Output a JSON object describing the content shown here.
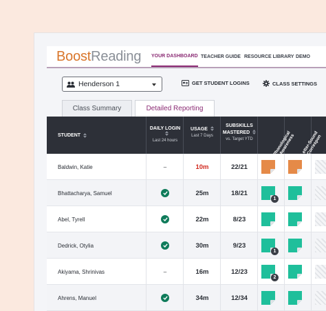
{
  "brand": {
    "part1": "Boost",
    "part2": "Reading"
  },
  "nav": [
    {
      "label": "YOUR DASHBOARD",
      "active": true
    },
    {
      "label": "TEACHER GUIDE",
      "active": false
    },
    {
      "label": "RESOURCE LIBRARY",
      "active": false
    },
    {
      "label": "DEMO",
      "active": false
    }
  ],
  "class_select": {
    "value": "Henderson 1"
  },
  "actions": {
    "logins": "GET STUDENT LOGINS",
    "settings": "CLASS SETTINGS"
  },
  "tabs": [
    {
      "label": "Class Summary",
      "active": false
    },
    {
      "label": "Detailed Reporting",
      "active": true
    }
  ],
  "columns": {
    "student": "STUDENT",
    "daily_login": "DAILY LOGIN",
    "daily_login_sub": "Last 24 hours",
    "usage": "USAGE",
    "usage_sub": "Last 7 Days",
    "subskills_1": "SUBSKILLS",
    "subskills_2": "MASTERED",
    "subskills_sub": "vs. Target YTD",
    "skill1_line1": "Phonological",
    "skill1_line2": "Awareness",
    "skill2_line1": "Letter-Sound",
    "skill2_line2": "Correspon"
  },
  "students": [
    {
      "name": "Baldwin, Katie",
      "login": "–",
      "usage": "10m",
      "usage_alert": true,
      "subskills": "22/21",
      "skill1": "orange",
      "skill1_badge": "",
      "skill2": "orange"
    },
    {
      "name": "Bhattacharya, Samuel",
      "login": "check",
      "usage": "25m",
      "usage_alert": false,
      "subskills": "18/21",
      "skill1": "teal",
      "skill1_badge": "1",
      "skill2": "teal"
    },
    {
      "name": "Abel, Tyrell",
      "login": "check",
      "usage": "22m",
      "usage_alert": false,
      "subskills": "8/23",
      "skill1": "teal",
      "skill1_badge": "",
      "skill2": "teal"
    },
    {
      "name": "Dedrick, Otylia",
      "login": "check",
      "usage": "30m",
      "usage_alert": false,
      "subskills": "9/23",
      "skill1": "teal",
      "skill1_badge": "1",
      "skill2": "teal"
    },
    {
      "name": "Akiyama, Shrinivas",
      "login": "–",
      "usage": "16m",
      "usage_alert": false,
      "subskills": "12/23",
      "skill1": "teal",
      "skill1_badge": "2",
      "skill2": "teal"
    },
    {
      "name": "Ahrens, Manuel",
      "login": "check",
      "usage": "34m",
      "usage_alert": false,
      "subskills": "12/34",
      "skill1": "teal",
      "skill1_badge": "",
      "skill2": "teal"
    }
  ],
  "colors": {
    "accent": "#8a2a73",
    "teal": "#1fbf9b",
    "orange": "#e58a48",
    "alert": "#d22a20",
    "check": "#0f7b5a"
  },
  "icons": {
    "class": "people-icon",
    "logins": "id-card-icon",
    "settings": "gear-icon",
    "login_ok": "check-circle-icon"
  }
}
